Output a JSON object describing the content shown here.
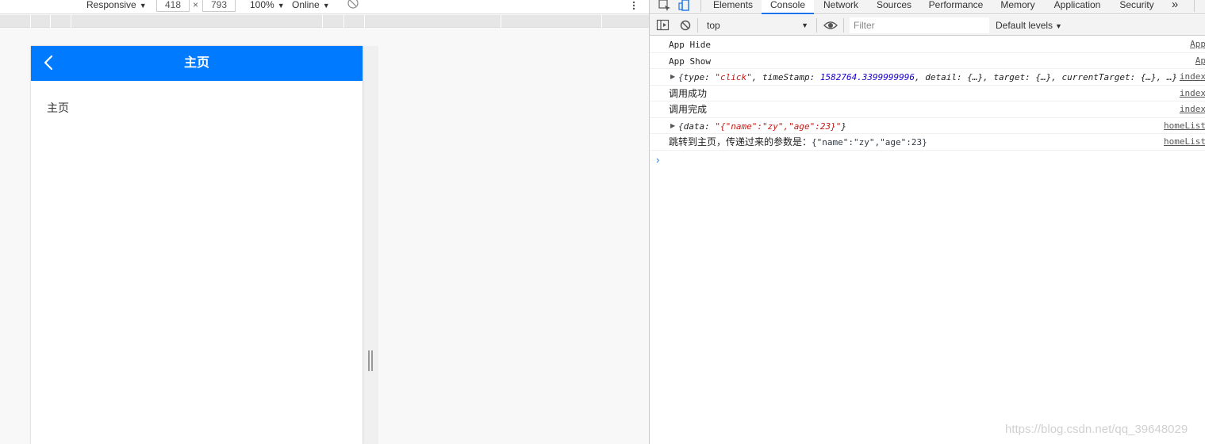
{
  "device_toolbar": {
    "device": "Responsive",
    "width": "418",
    "times": "×",
    "height": "793",
    "zoom": "100%",
    "throttle": "Online"
  },
  "app": {
    "nav_title": "主页",
    "content_text": "主页",
    "nav_color": "#007aff"
  },
  "devtools": {
    "tabs": [
      "Elements",
      "Console",
      "Network",
      "Sources",
      "Performance",
      "Memory",
      "Application",
      "Security"
    ],
    "active_tab": "Console",
    "more_tabs": "»",
    "context": "top",
    "filter_placeholder": "Filter",
    "levels": "Default levels"
  },
  "console": {
    "rows": [
      {
        "text": "App Hide",
        "source": "App"
      },
      {
        "text": "App Show",
        "source": "Ap"
      },
      {
        "source": "index",
        "obj": {
          "k1": "type: ",
          "v1": "\"click\"",
          "k2": ", timeStamp: ",
          "v2": "1582764.3399999996",
          "rest": ", detail: {…}, target: {…}, currentTarget: {…}, …}"
        }
      },
      {
        "text": "调用成功",
        "source": "index"
      },
      {
        "text": "调用完成",
        "source": "index"
      },
      {
        "source": "homeList",
        "obj": {
          "k1": "data: ",
          "v1": "\"{\"name\":\"zy\",\"age\":23}\"",
          "rest": "}"
        }
      },
      {
        "text": "跳转到主页，传递过来的参数是：",
        "mono": "{\"name\":\"zy\",\"age\":23}",
        "source": "homeList"
      }
    ],
    "prompt": "›"
  },
  "watermark": "https://blog.csdn.net/qq_39648029"
}
